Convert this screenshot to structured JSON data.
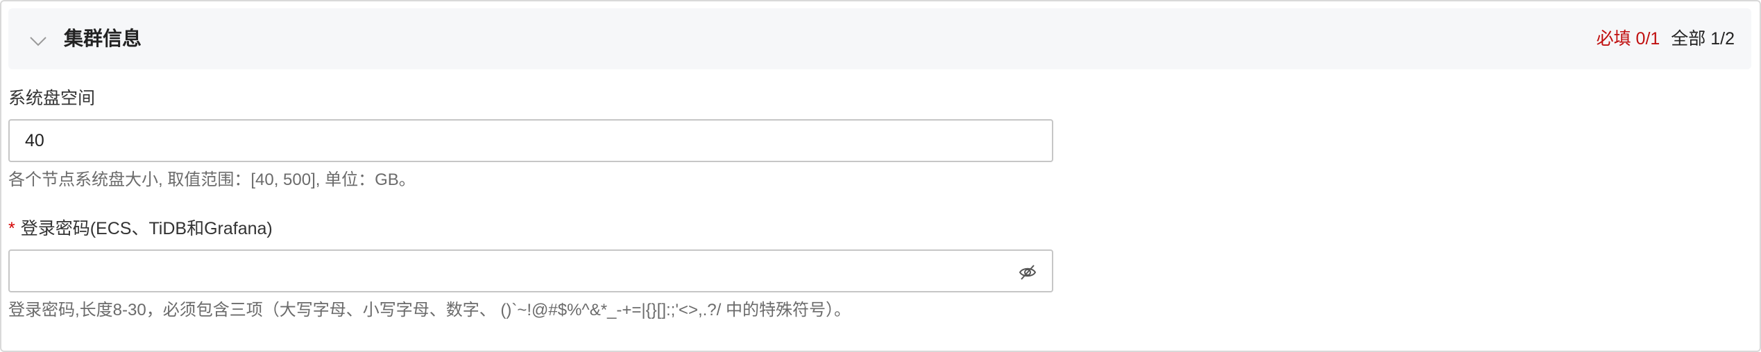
{
  "section": {
    "title": "集群信息",
    "required_count": "必填 0/1",
    "total_count": "全部 1/2",
    "collapse_icon": "chevron-down-icon"
  },
  "fields": {
    "system_disk": {
      "label": "系统盘空间",
      "value": "40",
      "help": "各个节点系统盘大小, 取值范围：[40, 500], 单位：GB。"
    },
    "password": {
      "required_mark": "*",
      "label": "登录密码(ECS、TiDB和Grafana)",
      "value": "",
      "toggle_icon": "eye-off-icon",
      "help": "登录密码,长度8-30，必须包含三项（大写字母、小写字母、数字、 ()`~!@#$%^&*_-+=|{}[]:;'<>,.?/ 中的特殊符号）。"
    }
  },
  "colors": {
    "required_red": "#c00f0f",
    "header_bg": "#f6f7f9",
    "border": "#c6c6c6"
  }
}
